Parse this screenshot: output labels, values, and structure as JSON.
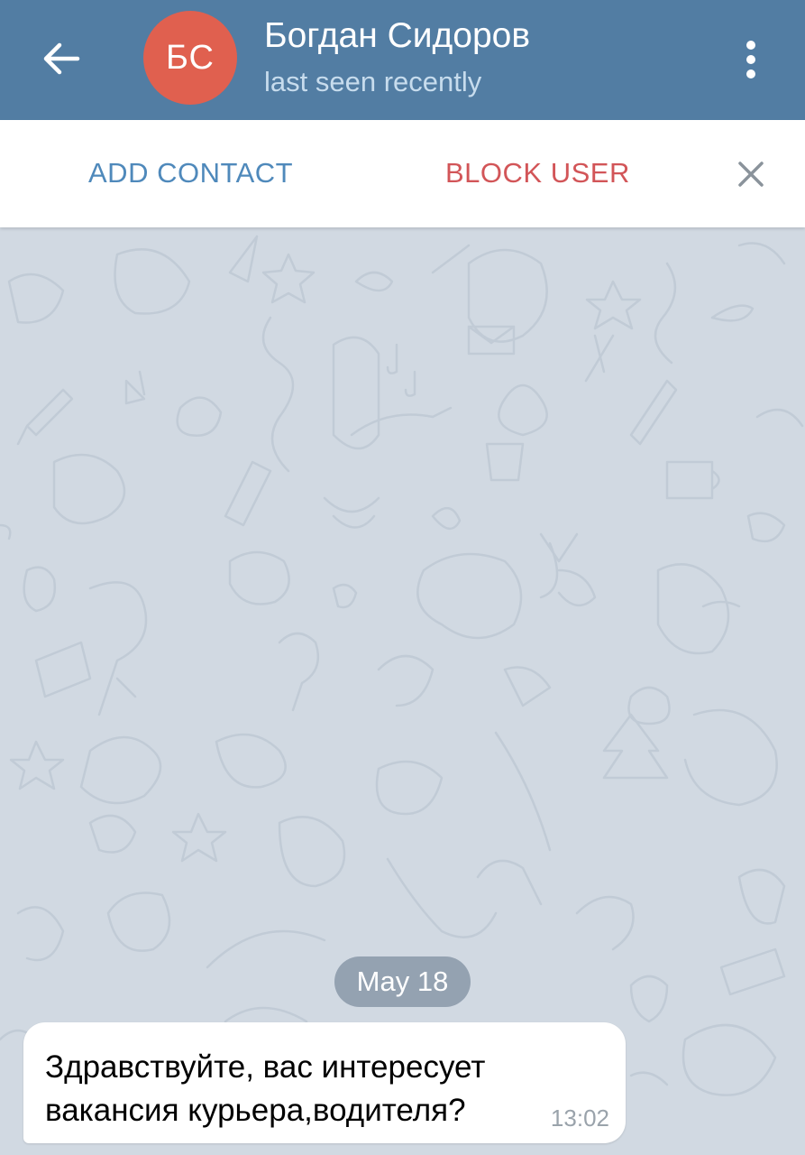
{
  "header": {
    "avatar_initials": "БС",
    "avatar_color": "#e0604f",
    "title": "Богдан Сидоров",
    "subtitle": "last seen recently",
    "back_icon": "arrow-left-icon",
    "menu_icon": "more-vertical-icon",
    "background": "#527da3"
  },
  "action_bar": {
    "add_contact_label": "ADD CONTACT",
    "block_user_label": "BLOCK USER",
    "close_icon": "close-icon",
    "add_color": "#4f89bb",
    "block_color": "#d25558"
  },
  "chat": {
    "date_separator": "May 18",
    "messages": [
      {
        "text": "Здравствуйте, вас интересует вакансия курьера,водителя?",
        "time": "13:02",
        "direction": "incoming"
      }
    ]
  }
}
